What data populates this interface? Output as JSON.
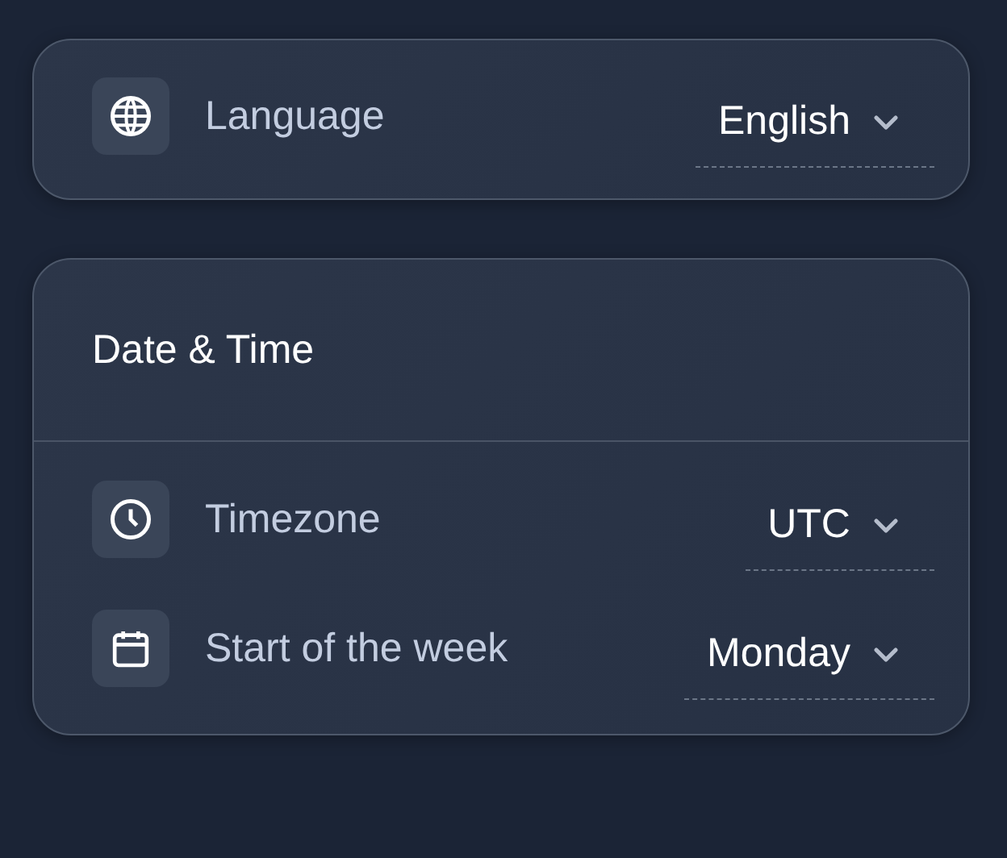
{
  "cards": [
    {
      "rows": [
        {
          "kind": "globe",
          "label": "Language",
          "value": "English"
        }
      ]
    },
    {
      "title": "Date & Time",
      "rows": [
        {
          "kind": "clock",
          "label": "Timezone",
          "value": "UTC"
        },
        {
          "kind": "calendar",
          "label": "Start of the week",
          "value": "Monday"
        }
      ]
    }
  ]
}
